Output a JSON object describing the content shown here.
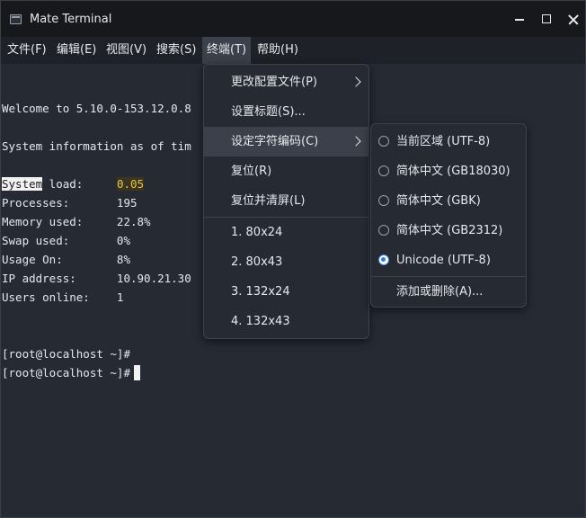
{
  "window": {
    "title": "Mate Terminal"
  },
  "menubar": {
    "items": [
      "文件(F)",
      "编辑(E)",
      "视图(V)",
      "搜索(S)",
      "终端(T)",
      "帮助(H)"
    ],
    "active_index": 4
  },
  "terminal": {
    "lines": [
      "",
      "Welcome to 5.10.0-153.12.0.8",
      "",
      "System information as of tim",
      "",
      "System load:     0.05",
      "Processes:       195",
      "Memory used:     22.8%",
      "Swap used:       0%",
      "Usage On:        8%",
      "IP address:      10.90.21.30",
      "Users online:    1",
      "",
      "",
      "[root@localhost ~]#",
      "[root@localhost ~]#"
    ],
    "sysload_label_highlight": "System",
    "sysload_label_rest": " load:     ",
    "sysload_value": "0.05",
    "prompt": "[root@localhost ~]#"
  },
  "terminal_menu": {
    "items": [
      {
        "label": "更改配置文件(P)",
        "submenu": true
      },
      {
        "label": "设置标题(S)...",
        "submenu": false
      },
      {
        "label": "设定字符编码(C)",
        "submenu": true,
        "highlighted": true
      },
      {
        "label": "复位(R)",
        "submenu": false
      },
      {
        "label": "复位并清屏(L)",
        "submenu": false
      },
      {
        "label": "1. 80x24",
        "submenu": false
      },
      {
        "label": "2. 80x43",
        "submenu": false
      },
      {
        "label": "3. 132x24",
        "submenu": false
      },
      {
        "label": "4. 132x43",
        "submenu": false
      }
    ]
  },
  "encoding_submenu": {
    "options": [
      {
        "label": "当前区域 (UTF-8)",
        "selected": false
      },
      {
        "label": "简体中文 (GB18030)",
        "selected": false
      },
      {
        "label": "简体中文 (GBK)",
        "selected": false
      },
      {
        "label": "简体中文 (GB2312)",
        "selected": false
      },
      {
        "label": "Unicode (UTF-8)",
        "selected": true
      }
    ],
    "add_remove_label": "添加或删除(A)..."
  },
  "colors": {
    "accent": "#2f7de1",
    "highlight_yellow": "#e8c34a",
    "background": "#262a33"
  }
}
